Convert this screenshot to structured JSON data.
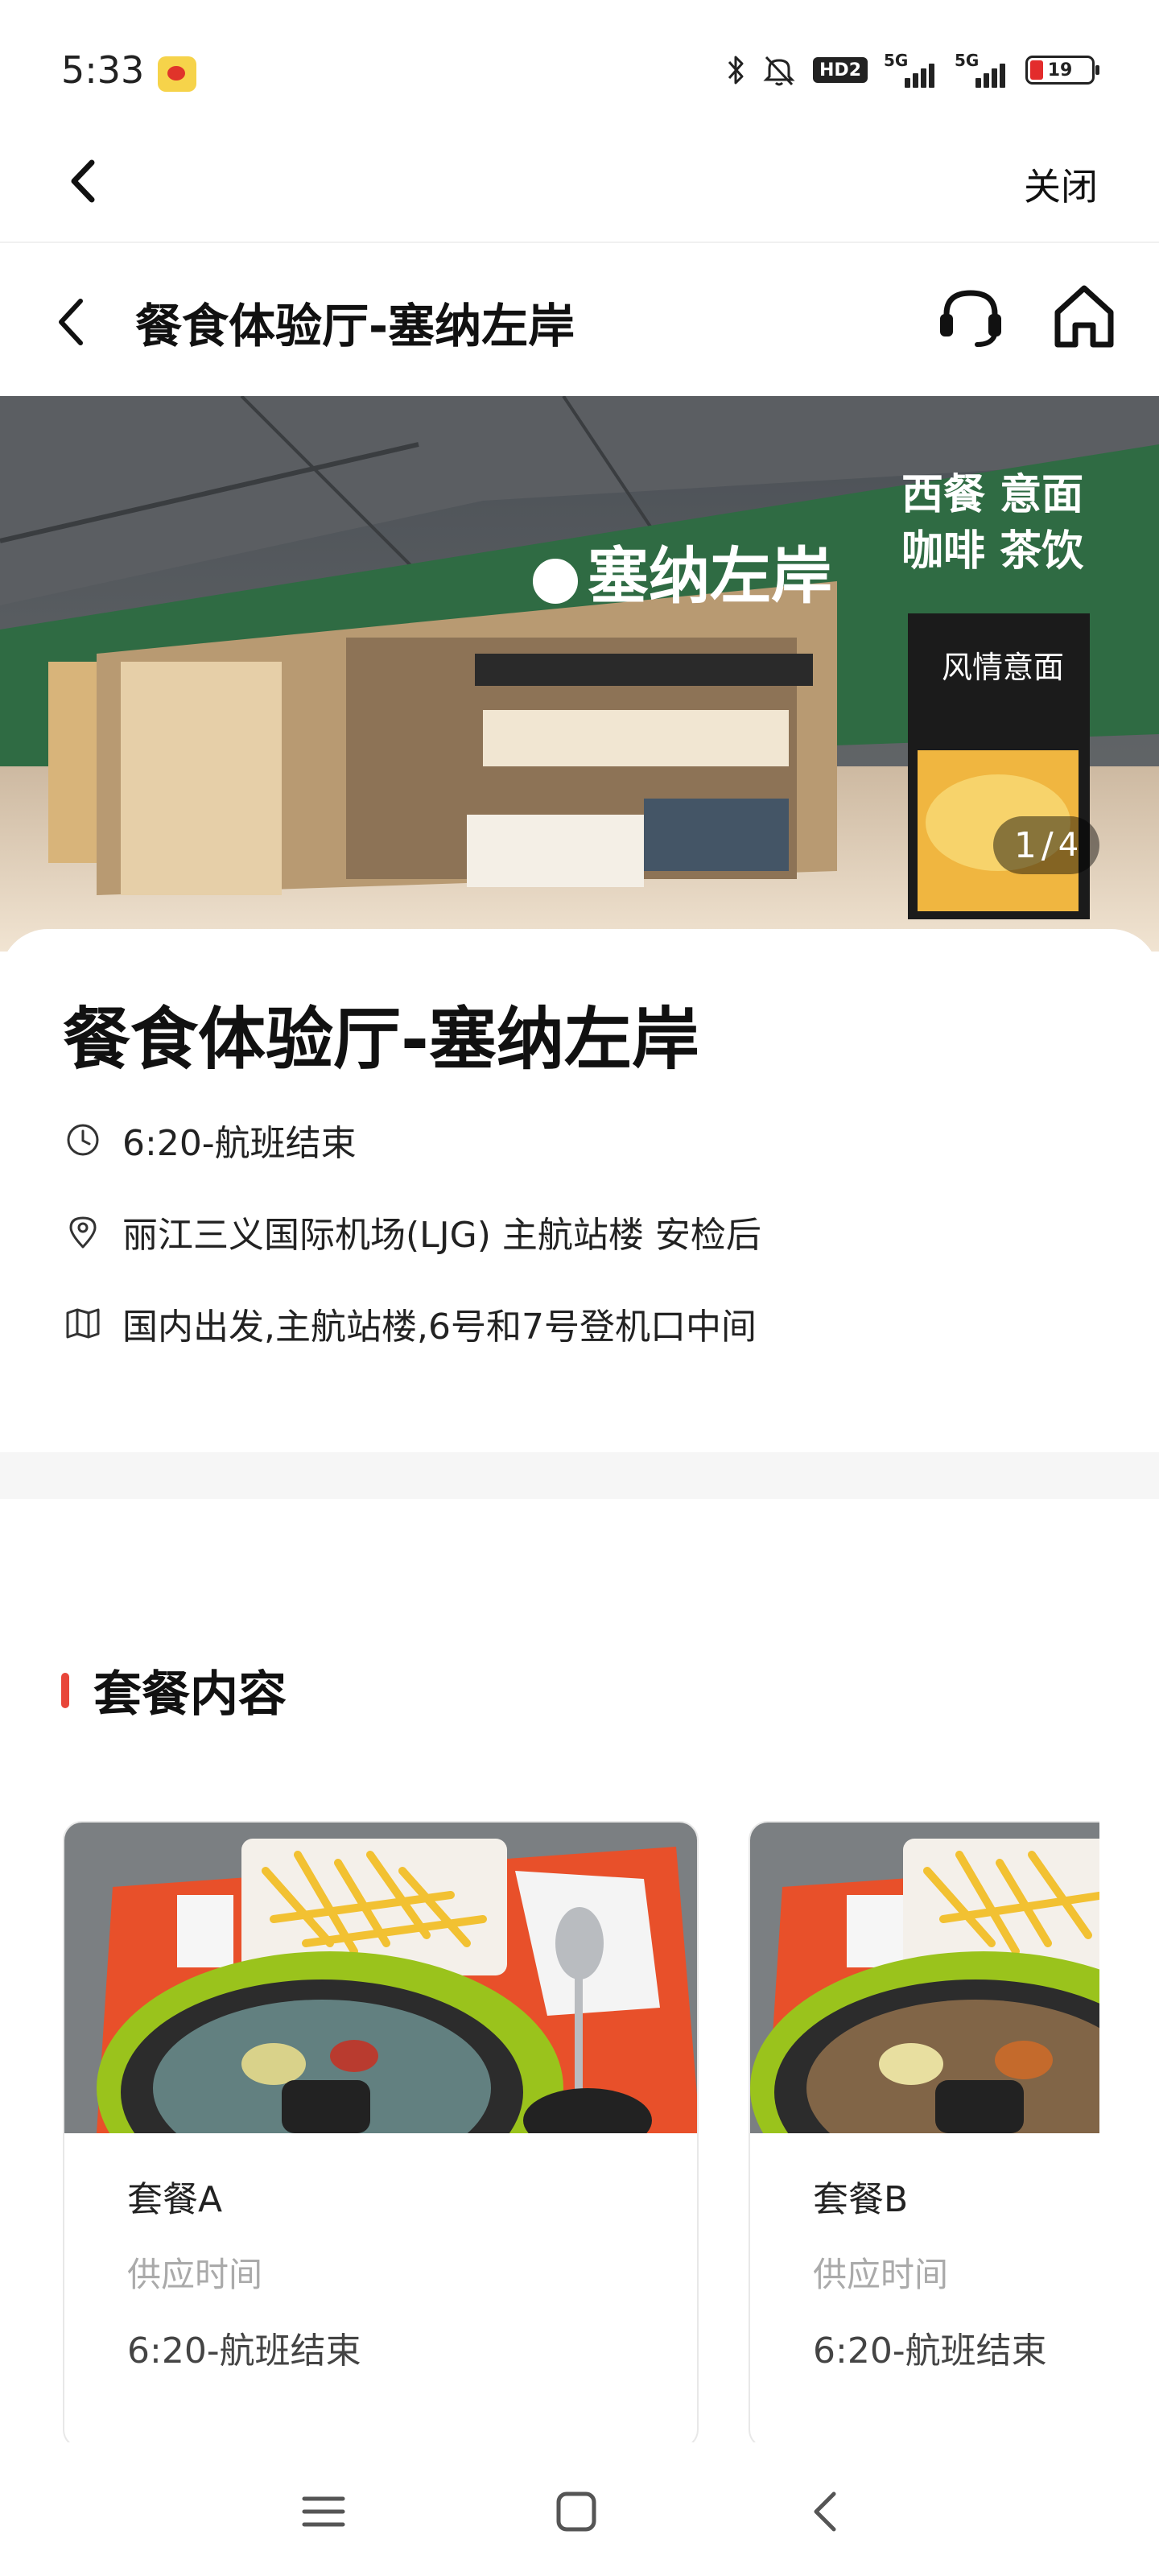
{
  "status_bar": {
    "time": "5:33",
    "hd_badge": "HD2",
    "network_1": "5G",
    "network_2": "5G",
    "battery_level": "19",
    "icons": [
      "weibo-icon",
      "bluetooth-icon",
      "mute-icon",
      "hd-icon",
      "signal-icon",
      "signal-icon",
      "battery-icon"
    ]
  },
  "outer_nav": {
    "back_icon": "chevron-left-icon",
    "close_label": "关闭"
  },
  "inner_nav": {
    "title": "餐食体验厅-塞纳左岸",
    "icons": [
      "chevron-left-icon",
      "headset-icon",
      "home-icon"
    ]
  },
  "hero": {
    "sign_brand": "塞纳左岸",
    "sign_tag_1": "西餐 意面",
    "sign_tag_2": "咖啡 茶饮",
    "poster_text": "风情意面",
    "pager_current": "1",
    "pager_total": "4"
  },
  "info": {
    "title": "餐食体验厅-塞纳左岸",
    "hours": "6:20-航班结束",
    "location": "丽江三义国际机场(LJG) 主航站楼 安检后",
    "directions": "国内出发,主航站楼,6号和7号登机口中间",
    "icons": [
      "clock-icon",
      "location-pin-icon",
      "map-icon"
    ]
  },
  "packages": {
    "section_title": "套餐内容",
    "items": [
      {
        "name": "套餐A",
        "time_label": "供应时间",
        "time_value": "6:20-航班结束"
      },
      {
        "name": "套餐B",
        "time_label": "供应时间",
        "time_value": "6:20-航班结束"
      }
    ]
  },
  "bottom_nav": {
    "icons": [
      "menu-icon",
      "home-square-icon",
      "back-triangle-icon"
    ]
  },
  "colors": {
    "accent": "#e8463a",
    "muted_text": "#aaaaaa",
    "divider_bg": "#f6f6f6"
  }
}
